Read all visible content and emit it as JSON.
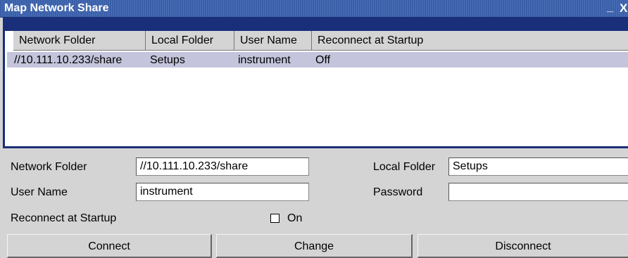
{
  "window": {
    "title": "Map Network Share",
    "minimize_glyph": "_",
    "close_glyph": "X"
  },
  "table": {
    "columns": [
      "Network Folder",
      "Local Folder",
      "User Name",
      "Reconnect at Startup"
    ],
    "rows": [
      [
        "//10.111.10.233/share",
        "Setups",
        "instrument",
        "Off"
      ]
    ]
  },
  "form": {
    "network_folder_label": "Network Folder",
    "network_folder_value": "//10.111.10.233/share",
    "local_folder_label": "Local Folder",
    "local_folder_value": "Setups",
    "user_name_label": "User Name",
    "user_name_value": "instrument",
    "password_label": "Password",
    "password_value": "",
    "reconnect_label": "Reconnect at Startup",
    "reconnect_checkbox_label": "On",
    "reconnect_checked": false
  },
  "buttons": {
    "connect": "Connect",
    "change": "Change",
    "disconnect": "Disconnect"
  },
  "colors": {
    "titlebar": "#3a5fa8",
    "selection": "#c4c4dc",
    "frame": "#1a2f7a"
  }
}
